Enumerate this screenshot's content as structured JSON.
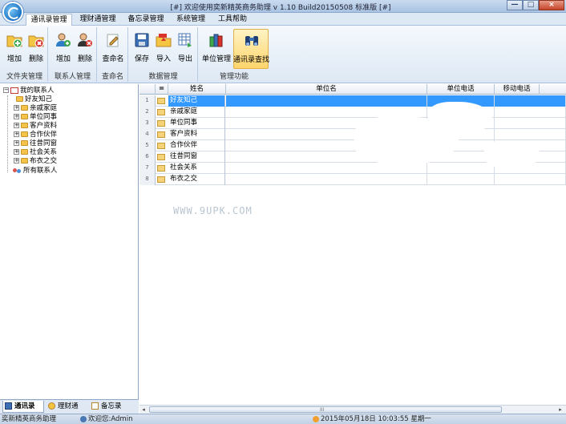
{
  "window": {
    "title": "[#] 欢迎使用奕新精英商务助理  v 1.10 Build20150508  标准版 [#]",
    "minimize_label": "—",
    "maximize_label": "□",
    "close_label": "×"
  },
  "menu_tabs": [
    "通讯录管理",
    "理财通管理",
    "备忘录管理",
    "系统管理",
    "工具帮助"
  ],
  "ribbon": {
    "groups": [
      {
        "label": "文件夹管理",
        "buttons": [
          "增加",
          "删除"
        ]
      },
      {
        "label": "联系人管理",
        "buttons": [
          "增加",
          "删除"
        ]
      },
      {
        "label": "查命名",
        "buttons": [
          "查命名"
        ]
      },
      {
        "label": "数据管理",
        "buttons": [
          "保存",
          "导入",
          "导出"
        ]
      },
      {
        "label": "管理功能",
        "buttons": [
          "单位管理",
          "通讯录查找"
        ]
      }
    ]
  },
  "tree": {
    "root": "我的联系人",
    "children": [
      "好友知己",
      "亲戚家庭",
      "单位同事",
      "客户资料",
      "合作伙伴",
      "往昔同窗",
      "社会关系",
      "布衣之交"
    ],
    "all": "所有联系人"
  },
  "left_tabs": [
    "通讯录",
    "理财通",
    "备忘录"
  ],
  "grid": {
    "corner": "=",
    "columns": [
      "姓名",
      "单位名",
      "单位电话",
      "移动电话"
    ],
    "rows": [
      {
        "num": "1",
        "name": "好友知己"
      },
      {
        "num": "2",
        "name": "亲戚家庭"
      },
      {
        "num": "3",
        "name": "单位同事"
      },
      {
        "num": "4",
        "name": "客户资料"
      },
      {
        "num": "5",
        "name": "合作伙伴"
      },
      {
        "num": "6",
        "name": "往昔同窗"
      },
      {
        "num": "7",
        "name": "社会关系"
      },
      {
        "num": "8",
        "name": "布衣之交"
      }
    ],
    "selected_row": 1
  },
  "watermark": "WWW.9UPK.COM",
  "scrollbar": {
    "left": "◂",
    "right": "▸",
    "grip": "III"
  },
  "status": {
    "app": "奕新精英商务助理",
    "user": "欢迎您:Admin",
    "datetime": "2015年05月18日  10:03:55  星期一"
  }
}
